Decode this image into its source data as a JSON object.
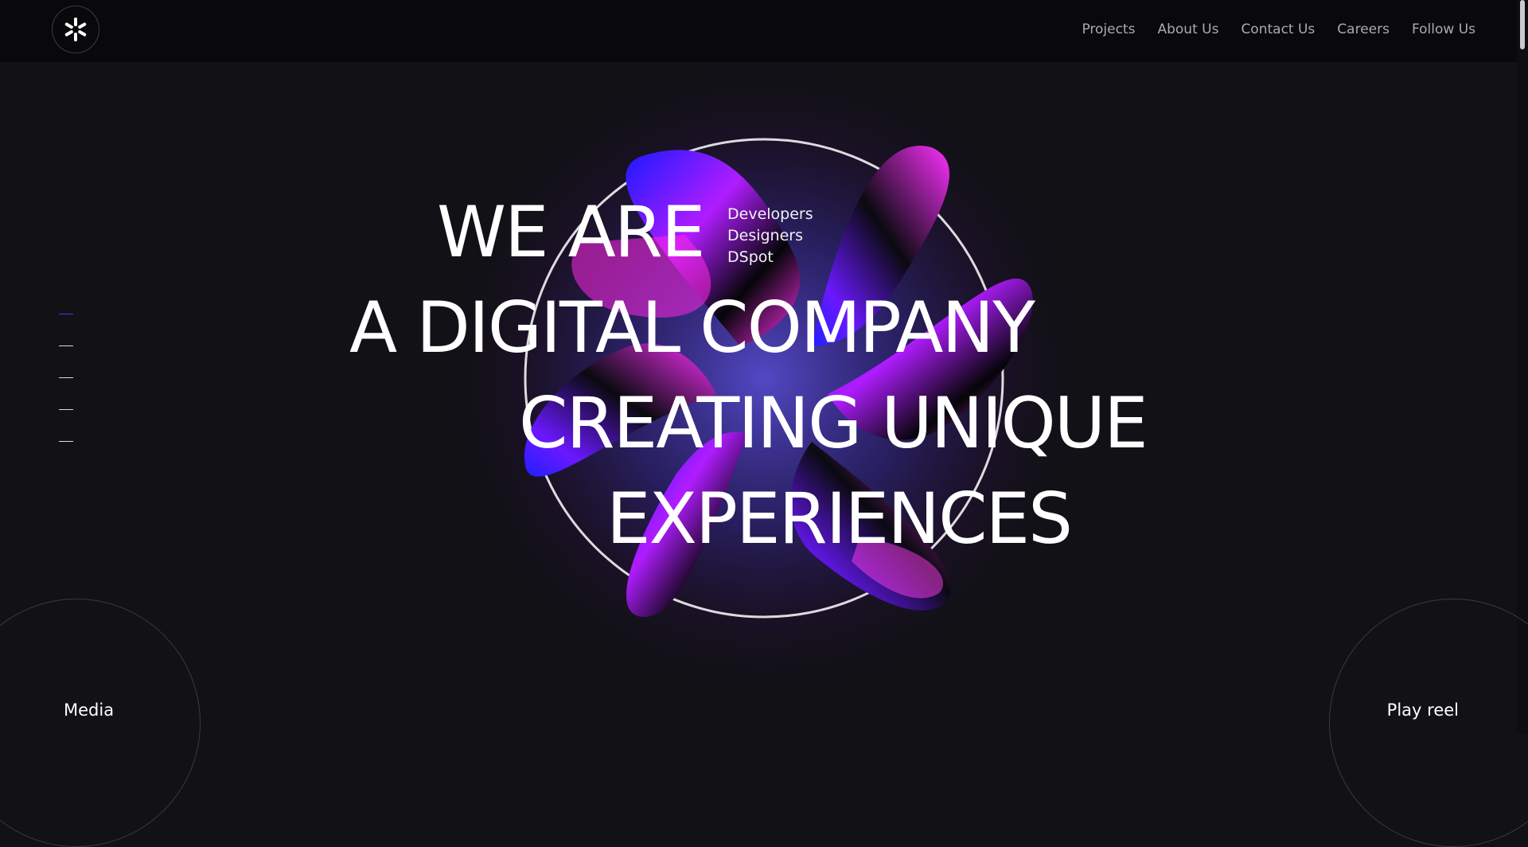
{
  "header": {
    "logo_icon": "asterisk-logo-icon",
    "nav": [
      "Projects",
      "About Us",
      "Contact Us",
      "Careers",
      "Follow Us"
    ]
  },
  "hero": {
    "line1": "WE ARE",
    "roles": [
      "Developers",
      "Designers",
      "DSpot"
    ],
    "line2": "A DIGITAL COMPANY",
    "line3": "CREATING UNIQUE",
    "line4": "EXPERIENCES"
  },
  "side_indicator": {
    "count": 5,
    "active_index": 0
  },
  "footer": {
    "left_link": "Media",
    "right_link": "Play reel"
  },
  "colors": {
    "background": "#111116",
    "header": "#09090c",
    "accent": "#3b3bff",
    "magenta": "#d020ff"
  }
}
